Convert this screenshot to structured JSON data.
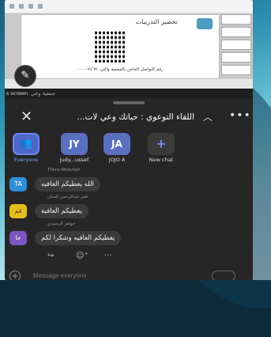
{
  "shared_screen": {
    "slide_title": "تحضير التدريبات",
    "slide_footer": "رقم التواصل الخاص بالجمعية والتي :٧٤٦٧-٠٠٠٠",
    "screen_label": "s screen",
    "screen_label_org": "جمعية وعي"
  },
  "chat": {
    "title": "اللقاء التوعوي : حياتك وعي لات...",
    "close_icon": "close-icon",
    "recipients": [
      {
        "initials": "",
        "label": "Everyone",
        "icon": "people-icon"
      },
      {
        "initials": "JY",
        "label": "Judy...ussef"
      },
      {
        "initials": "JA",
        "label": "JOJO A"
      },
      {
        "initials": "+",
        "label": "New chat",
        "icon": "plus-icon"
      }
    ],
    "messages": [
      {
        "sender": "Thkra Abdullah",
        "initials": "TA",
        "color": "#2f8fd8",
        "text": "الله يعطيكم العافيه"
      },
      {
        "sender": "قمر عبدالرحمن المنان",
        "initials": "قم",
        "color": "#e1c01e",
        "text": "يعطيكم العافية"
      },
      {
        "sender": "جواهر الرشيدي",
        "initials": "جا",
        "color": "#7b55c0",
        "text": "يعطيكم العافيه وشكرا لكم"
      }
    ],
    "reactions": [
      "reply-icon",
      "add-emoji-icon",
      "more-icon"
    ],
    "compose_placeholder": "Message everyone"
  }
}
